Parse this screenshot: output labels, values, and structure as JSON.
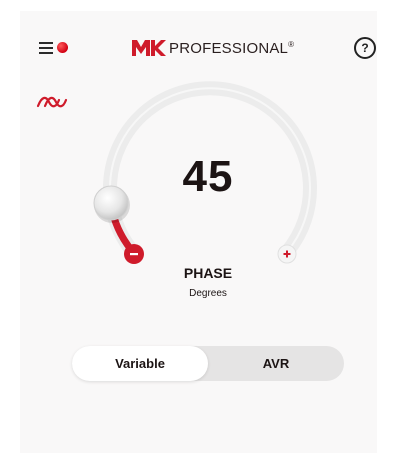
{
  "header": {
    "brand_text": "PROFESSIONAL",
    "brand_mark": "®",
    "logo_letters": "MK",
    "help_label": "?"
  },
  "icons": {
    "menu": "hamburger-menu-icon",
    "status": "status-dot-icon",
    "help": "help-circle-icon",
    "wave": "phase-wave-icon",
    "minus": "minus-icon",
    "plus": "plus-icon"
  },
  "dial": {
    "value": "45",
    "label": "PHASE",
    "unit": "Degrees",
    "minus_label": "−",
    "plus_label": "+"
  },
  "mode_toggle": {
    "options": [
      "Variable",
      "AVR"
    ],
    "selected": "Variable"
  },
  "colors": {
    "accent": "#cf1b2b",
    "text": "#1c1414",
    "track": "#ececec",
    "card": "#f9f8f8",
    "toggle_bg": "#e5e4e4"
  }
}
